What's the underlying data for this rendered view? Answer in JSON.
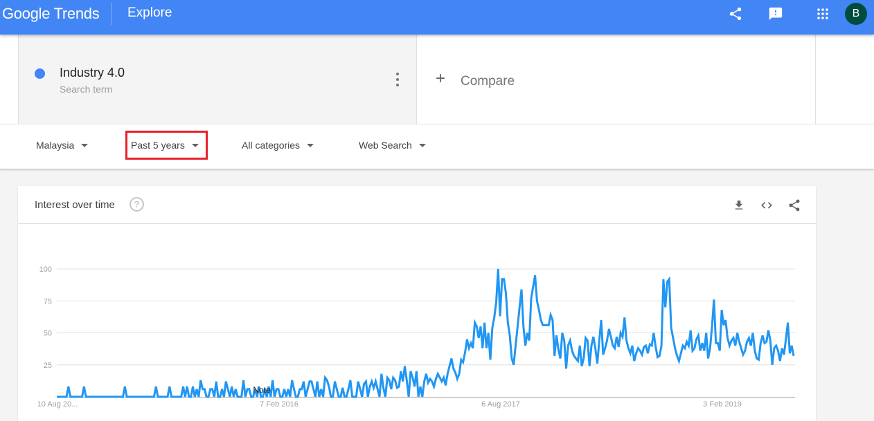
{
  "header": {
    "logo_google": "Google",
    "logo_trends": "Trends",
    "section": "Explore",
    "avatar_initial": "B",
    "icons": [
      "share-icon",
      "feedback-icon",
      "apps-icon"
    ]
  },
  "term": {
    "name": "Industry 4.0",
    "type": "Search term",
    "color": "#4285f4"
  },
  "compare": {
    "label": "Compare"
  },
  "filters": {
    "region": "Malaysia",
    "time": "Past 5 years",
    "category": "All categories",
    "search_type": "Web Search"
  },
  "interest_card": {
    "title": "Interest over time",
    "help": "?",
    "actions": [
      "download-icon",
      "embed-icon",
      "share-icon"
    ]
  },
  "chart_data": {
    "type": "line",
    "title": "Interest over time",
    "xlabel": "",
    "ylabel": "",
    "ylim": [
      0,
      100
    ],
    "yticks": [
      25,
      50,
      75,
      100
    ],
    "grid": true,
    "legend": "none",
    "x_tick_labels": [
      "10 Aug 20...",
      "7 Feb 2016",
      "6 Aug 2017",
      "3 Feb 2019"
    ],
    "annotation": "Note",
    "series": [
      {
        "name": "Industry 4.0",
        "color": "#2196f3",
        "values": [
          0,
          0,
          0,
          0,
          0,
          0,
          8,
          0,
          0,
          0,
          0,
          0,
          0,
          0,
          8,
          0,
          0,
          0,
          0,
          0,
          0,
          0,
          0,
          0,
          0,
          0,
          0,
          0,
          0,
          0,
          0,
          0,
          0,
          0,
          0,
          8,
          0,
          0,
          0,
          0,
          0,
          0,
          0,
          0,
          0,
          0,
          0,
          0,
          0,
          0,
          0,
          8,
          0,
          0,
          0,
          0,
          0,
          0,
          8,
          0,
          0,
          0,
          0,
          0,
          0,
          8,
          0,
          8,
          0,
          0,
          8,
          0,
          6,
          0,
          13,
          6,
          6,
          0,
          0,
          6,
          6,
          0,
          12,
          0,
          0,
          6,
          0,
          12,
          6,
          0,
          8,
          0,
          6,
          0,
          0,
          0,
          13,
          0,
          6,
          6,
          0,
          0,
          6,
          0,
          8,
          0,
          0,
          6,
          0,
          8,
          0,
          13,
          0,
          6,
          6,
          0,
          0,
          6,
          0,
          6,
          0,
          13,
          6,
          0,
          0,
          6,
          6,
          12,
          0,
          6,
          12,
          12,
          6,
          0,
          12,
          0,
          6,
          0,
          15,
          13,
          8,
          0,
          0,
          12,
          6,
          0,
          0,
          7,
          0,
          0,
          6,
          13,
          0,
          0,
          0,
          12,
          6,
          0,
          10,
          12,
          0,
          8,
          12,
          7,
          12,
          6,
          0,
          18,
          7,
          0,
          15,
          13,
          6,
          15,
          13,
          7,
          8,
          20,
          12,
          24,
          13,
          0,
          20,
          15,
          8,
          20,
          0,
          8,
          0,
          12,
          18,
          11,
          14,
          12,
          8,
          14,
          18,
          15,
          12,
          15,
          9,
          18,
          24,
          30,
          22,
          19,
          14,
          18,
          29,
          27,
          35,
          45,
          38,
          42,
          38,
          58,
          55,
          46,
          55,
          38,
          58,
          38,
          50,
          29,
          54,
          62,
          74,
          100,
          63,
          92,
          92,
          81,
          58,
          48,
          30,
          25,
          40,
          55,
          70,
          84,
          55,
          40,
          50,
          44,
          77,
          86,
          95,
          75,
          68,
          60,
          56,
          56,
          56,
          56,
          64,
          60,
          32,
          48,
          37,
          30,
          50,
          44,
          22,
          40,
          44,
          36,
          32,
          30,
          28,
          40,
          24,
          30,
          46,
          44,
          24,
          40,
          47,
          38,
          26,
          44,
          60,
          33,
          38,
          44,
          53,
          47,
          40,
          38,
          47,
          39,
          50,
          47,
          62,
          44,
          38,
          34,
          40,
          28,
          34,
          38,
          36,
          33,
          39,
          40,
          34,
          41,
          40,
          50,
          39,
          31,
          32,
          40,
          92,
          70,
          90,
          92,
          54,
          46,
          38,
          32,
          28,
          34,
          40,
          38,
          43,
          40,
          52,
          36,
          38,
          45,
          48,
          36,
          42,
          36,
          50,
          30,
          38,
          55,
          76,
          42,
          42,
          36,
          68,
          56,
          60,
          46,
          40,
          44,
          46,
          40,
          50,
          43,
          38,
          33,
          36,
          43,
          46,
          40,
          50,
          36,
          30,
          29,
          42,
          48,
          42,
          43,
          52,
          44,
          25,
          38,
          40,
          36,
          28,
          38,
          33,
          45,
          58,
          34,
          40,
          32
        ]
      }
    ]
  }
}
